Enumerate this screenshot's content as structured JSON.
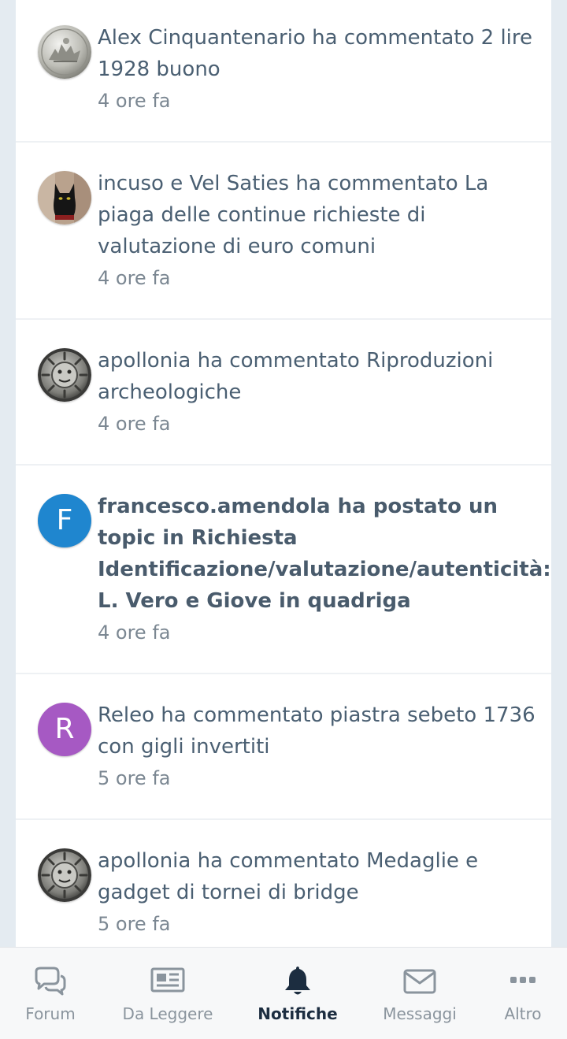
{
  "notifications": [
    {
      "text": "Alex Cinquantenario ha commentato 2 lire 1928 buono",
      "time": "4 ore fa",
      "avatar": "coin-quadriga-avatar",
      "unread": false
    },
    {
      "text": "incuso e Vel Saties ha commentato La piaga delle continue richieste di valutazione di euro comuni",
      "time": "4 ore fa",
      "avatar": "black-cat-avatar",
      "unread": false
    },
    {
      "text": "apollonia ha commentato Riproduzioni archeologiche",
      "time": "4 ore fa",
      "avatar": "gorgon-coin-avatar",
      "unread": false
    },
    {
      "text": "francesco.amendola ha postato un topic in Richiesta Identificazione/valutazione/autenticità: L. Vero e Giove in quadriga",
      "time": "4 ore fa",
      "avatar_letter": "F",
      "avatar_color": "#1f86cf",
      "unread": true
    },
    {
      "text": "Releo ha commentato piastra sebeto 1736 con gigli invertiti",
      "time": "5 ore fa",
      "avatar_letter": "R",
      "avatar_color": "#a659c3",
      "unread": false
    },
    {
      "text": "apollonia ha commentato Medaglie e gadget di tornei di bridge",
      "time": "5 ore fa",
      "avatar": "gorgon-coin-avatar",
      "unread": false
    }
  ],
  "tabbar": {
    "tabs": [
      {
        "label": "Forum",
        "icon": "chat-bubbles-icon",
        "active": false
      },
      {
        "label": "Da Leggere",
        "icon": "newspaper-icon",
        "active": false
      },
      {
        "label": "Notifiche",
        "icon": "bell-icon",
        "active": true
      },
      {
        "label": "Messaggi",
        "icon": "envelope-icon",
        "active": false
      },
      {
        "label": "Altro",
        "icon": "more-dots-icon",
        "active": false
      }
    ],
    "active_color": "#1c2d40",
    "inactive_color": "#8a949d"
  }
}
